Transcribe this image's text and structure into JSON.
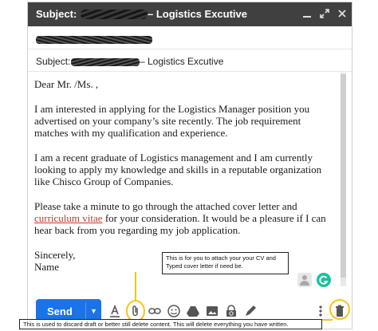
{
  "titlebar": {
    "subject_prefix": "Subject:",
    "subject_suffix": "– Logistics Excutive",
    "icons": [
      "minimize-icon",
      "expand-icon",
      "close-icon"
    ]
  },
  "fields": {
    "subject_label": "Subject:",
    "subject_suffix": "– Logistics Excutive"
  },
  "body": {
    "greeting": "Dear Mr. /Ms. ,",
    "para1": "I am interested in applying for the Logistics Manager position you advertised on your company’s site recently. The job requirement matches with my qualification and experience.",
    "para2": "I am a recent graduate of Logistics management and I am currently looking to apply my knowledge and skills in a reputable organization like Chisco Group of Companies.",
    "para3_before": "Please take a minute to go through the attached cover letter and ",
    "para3_link": "curriculum vitae",
    "para3_after": " for your consideration. It would be a pleasure if I can hear back from you regarding my job application.",
    "closing": "Sincerely,",
    "name": "Name"
  },
  "annotations": {
    "attach_note": "This is for you to attach your your CV and Typed cover letter if need be.",
    "discard_note": "This is used to discard draft or better still delete content. This will delete everything you have written."
  },
  "toolbar": {
    "send_label": "Send",
    "accent_color": "#1a73e8",
    "highlight_color": "#f5c518",
    "tools": [
      "format-text-icon",
      "attach-icon",
      "link-icon",
      "emoji-icon",
      "drive-icon",
      "photo-icon",
      "confidential-icon",
      "signature-icon",
      "more-options-icon",
      "discard-draft-icon"
    ]
  }
}
